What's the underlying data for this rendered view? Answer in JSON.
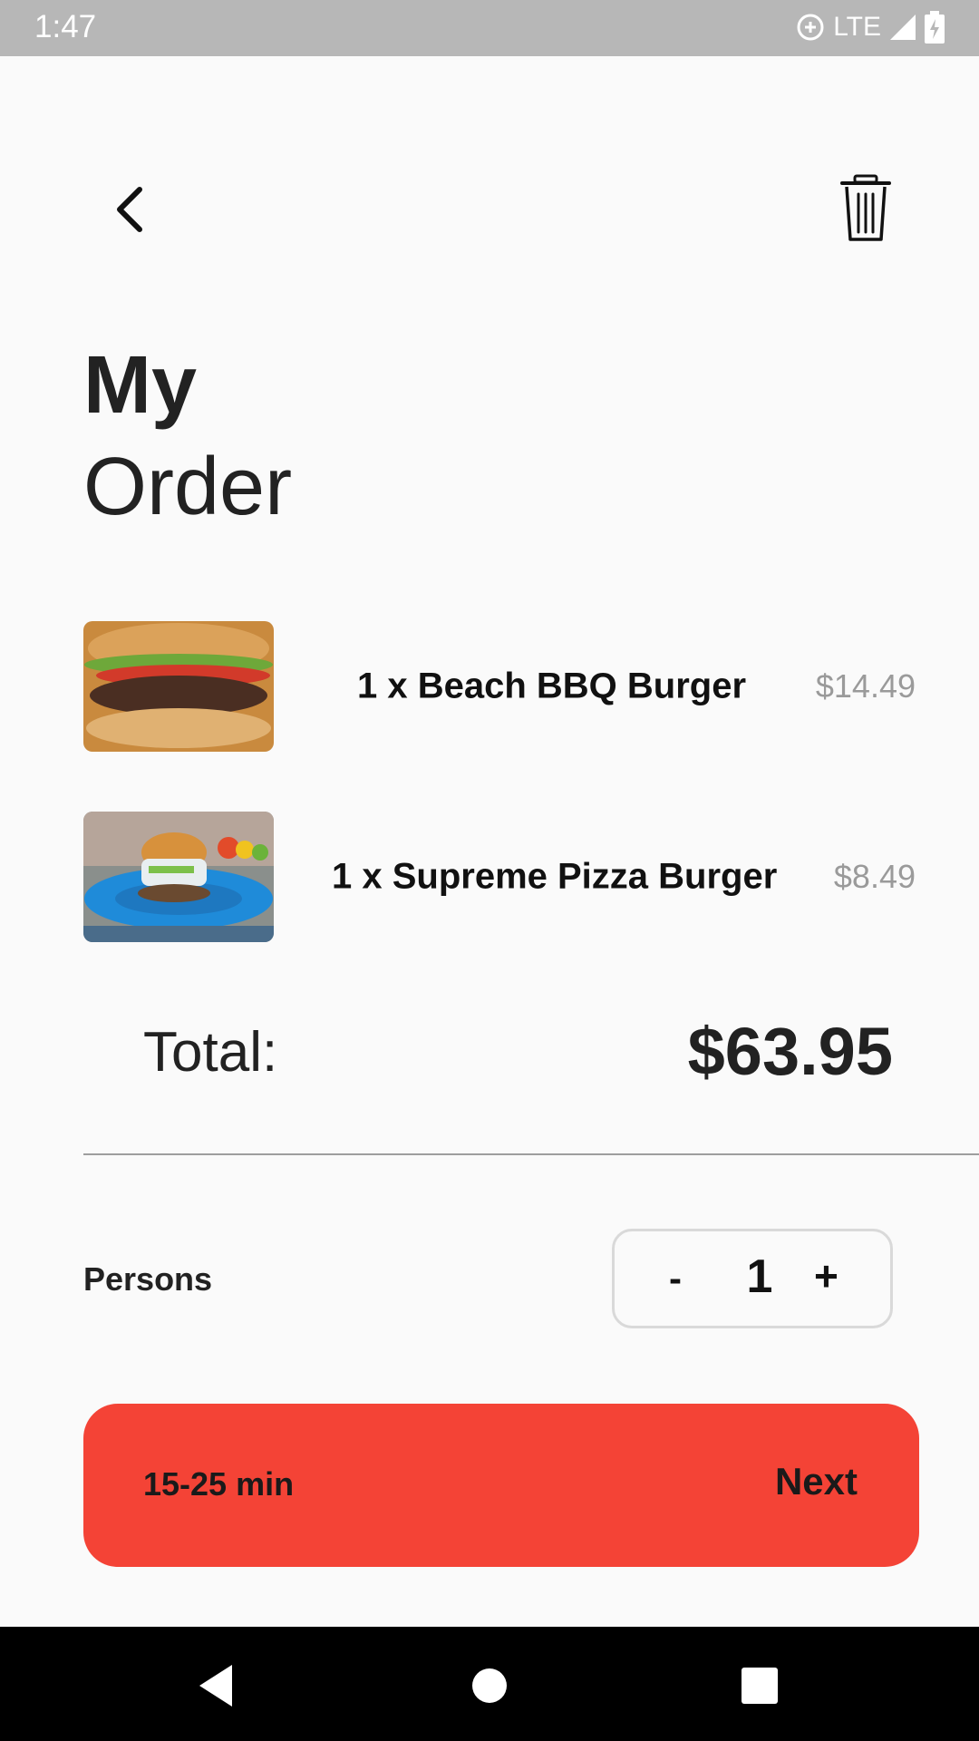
{
  "status_bar": {
    "time": "1:47",
    "network": "LTE"
  },
  "header": {
    "back_icon": "chevron-left-icon",
    "trash_icon": "trash-icon"
  },
  "title": {
    "line1": "My",
    "line2": "Order"
  },
  "items": [
    {
      "quantity_name": "1 x Beach BBQ Burger",
      "price": "$14.49",
      "image": "burger-photo"
    },
    {
      "quantity_name": "1 x Supreme Pizza Burger",
      "price": "$8.49",
      "image": "burger-on-blue-plate-photo"
    }
  ],
  "total": {
    "label": "Total:",
    "value": "$63.95"
  },
  "persons": {
    "label": "Persons",
    "minus": "-",
    "value": "1",
    "plus": "+"
  },
  "cta": {
    "time": "15-25 min",
    "next": "Next"
  },
  "colors": {
    "accent": "#f44336",
    "status_bar": "#b7b7b7",
    "background": "#fafafa"
  }
}
